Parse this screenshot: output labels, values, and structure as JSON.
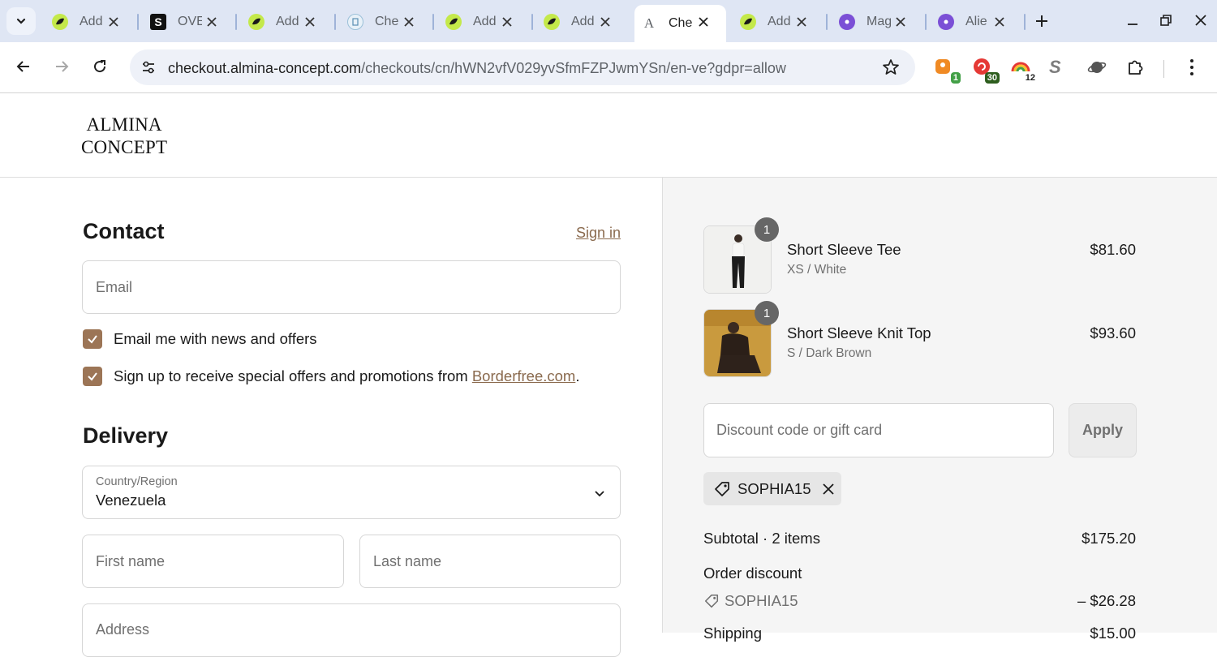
{
  "browser": {
    "tabs": [
      {
        "title": "Add",
        "favicon": "green-leaf-icon"
      },
      {
        "title": "OVE",
        "favicon": "s-logo-icon"
      },
      {
        "title": "Add",
        "favicon": "green-leaf-icon"
      },
      {
        "title": "Che",
        "favicon": "doc-icon"
      },
      {
        "title": "Add",
        "favicon": "green-leaf-icon"
      },
      {
        "title": "Add",
        "favicon": "green-leaf-icon"
      },
      {
        "title": "Che",
        "favicon": "almina-a-icon",
        "active": true
      },
      {
        "title": "Add",
        "favicon": "green-leaf-icon"
      },
      {
        "title": "Mag",
        "favicon": "purple-flower-icon"
      },
      {
        "title": "Alie",
        "favicon": "purple-flower-icon"
      }
    ],
    "url_host": "checkout.almina-concept.com",
    "url_path": "/checkouts/cn/hWN2vfV029yvSfmFZPJwmYSn/en-ve?gdpr=allow",
    "extensions": [
      {
        "name": "orange-extension-icon",
        "badge": "1",
        "badge_color": "#43a047"
      },
      {
        "name": "red-extension-icon",
        "badge": "30",
        "badge_color": "#2e5e1e"
      },
      {
        "name": "rainbow-extension-icon",
        "badge": "12",
        "badge_color": "#ffffff"
      },
      {
        "name": "s-extension-icon",
        "badge": ""
      },
      {
        "name": "planet-extension-icon",
        "badge": ""
      }
    ]
  },
  "header": {
    "logo_line1": "ALMINA",
    "logo_line2": "CONCEPT"
  },
  "contact": {
    "title": "Contact",
    "sign_in": "Sign in",
    "email_placeholder": "Email",
    "news_checkbox": "Email me with news and offers",
    "promo_checkbox_prefix": "Sign up to receive special offers and promotions from ",
    "promo_checkbox_brand": "Borderfree.com",
    "promo_checkbox_suffix": "."
  },
  "delivery": {
    "title": "Delivery",
    "country_label": "Country/Region",
    "country_value": "Venezuela",
    "first_name_placeholder": "First name",
    "last_name_placeholder": "Last name",
    "address_placeholder": "Address"
  },
  "order": {
    "items": [
      {
        "name": "Short Sleeve Tee",
        "variant": "XS / White",
        "price": "$81.60",
        "qty": "1"
      },
      {
        "name": "Short Sleeve Knit Top",
        "variant": "S / Dark Brown",
        "price": "$93.60",
        "qty": "1"
      }
    ],
    "discount_placeholder": "Discount code or gift card",
    "apply_label": "Apply",
    "applied_code": "SOPHIA15",
    "subtotal_label": "Subtotal · 2 items",
    "subtotal_value": "$175.20",
    "order_discount_label": "Order discount",
    "order_discount_code": "SOPHIA15",
    "order_discount_value": "– $26.28",
    "shipping_label": "Shipping",
    "shipping_value": "$15.00"
  },
  "colors": {
    "accent": "#9c7556",
    "link": "#8a6a4e",
    "summary_bg": "#f5f5f5"
  }
}
